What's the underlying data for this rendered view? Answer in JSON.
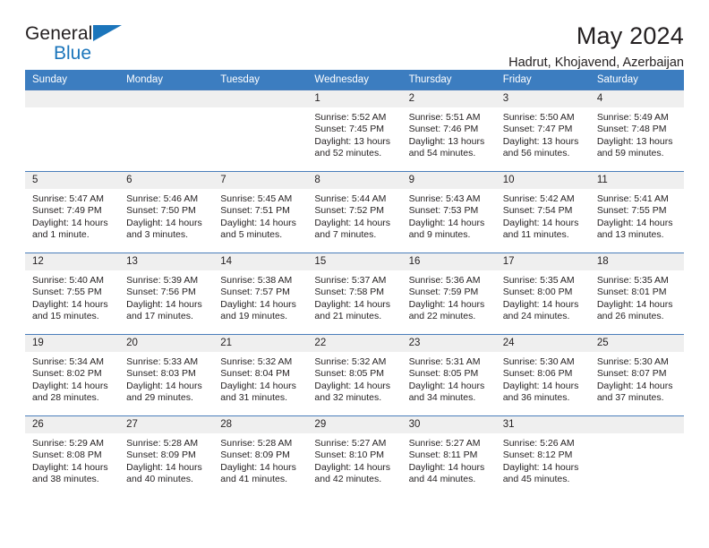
{
  "brand": {
    "name_part1": "General",
    "name_part2": "Blue",
    "accent_color": "#1b75bb"
  },
  "header": {
    "title": "May 2024",
    "subtitle": "Hadrut, Khojavend, Azerbaijan"
  },
  "calendar": {
    "header_bg": "#3c7dc0",
    "daynum_bg": "#efefef",
    "weekday_headers": [
      "Sunday",
      "Monday",
      "Tuesday",
      "Wednesday",
      "Thursday",
      "Friday",
      "Saturday"
    ],
    "weeks": [
      [
        {
          "day": "",
          "sunrise": "",
          "sunset": "",
          "daylight_line1": "",
          "daylight_line2": ""
        },
        {
          "day": "",
          "sunrise": "",
          "sunset": "",
          "daylight_line1": "",
          "daylight_line2": ""
        },
        {
          "day": "",
          "sunrise": "",
          "sunset": "",
          "daylight_line1": "",
          "daylight_line2": ""
        },
        {
          "day": "1",
          "sunrise": "Sunrise: 5:52 AM",
          "sunset": "Sunset: 7:45 PM",
          "daylight_line1": "Daylight: 13 hours",
          "daylight_line2": "and 52 minutes."
        },
        {
          "day": "2",
          "sunrise": "Sunrise: 5:51 AM",
          "sunset": "Sunset: 7:46 PM",
          "daylight_line1": "Daylight: 13 hours",
          "daylight_line2": "and 54 minutes."
        },
        {
          "day": "3",
          "sunrise": "Sunrise: 5:50 AM",
          "sunset": "Sunset: 7:47 PM",
          "daylight_line1": "Daylight: 13 hours",
          "daylight_line2": "and 56 minutes."
        },
        {
          "day": "4",
          "sunrise": "Sunrise: 5:49 AM",
          "sunset": "Sunset: 7:48 PM",
          "daylight_line1": "Daylight: 13 hours",
          "daylight_line2": "and 59 minutes."
        }
      ],
      [
        {
          "day": "5",
          "sunrise": "Sunrise: 5:47 AM",
          "sunset": "Sunset: 7:49 PM",
          "daylight_line1": "Daylight: 14 hours",
          "daylight_line2": "and 1 minute."
        },
        {
          "day": "6",
          "sunrise": "Sunrise: 5:46 AM",
          "sunset": "Sunset: 7:50 PM",
          "daylight_line1": "Daylight: 14 hours",
          "daylight_line2": "and 3 minutes."
        },
        {
          "day": "7",
          "sunrise": "Sunrise: 5:45 AM",
          "sunset": "Sunset: 7:51 PM",
          "daylight_line1": "Daylight: 14 hours",
          "daylight_line2": "and 5 minutes."
        },
        {
          "day": "8",
          "sunrise": "Sunrise: 5:44 AM",
          "sunset": "Sunset: 7:52 PM",
          "daylight_line1": "Daylight: 14 hours",
          "daylight_line2": "and 7 minutes."
        },
        {
          "day": "9",
          "sunrise": "Sunrise: 5:43 AM",
          "sunset": "Sunset: 7:53 PM",
          "daylight_line1": "Daylight: 14 hours",
          "daylight_line2": "and 9 minutes."
        },
        {
          "day": "10",
          "sunrise": "Sunrise: 5:42 AM",
          "sunset": "Sunset: 7:54 PM",
          "daylight_line1": "Daylight: 14 hours",
          "daylight_line2": "and 11 minutes."
        },
        {
          "day": "11",
          "sunrise": "Sunrise: 5:41 AM",
          "sunset": "Sunset: 7:55 PM",
          "daylight_line1": "Daylight: 14 hours",
          "daylight_line2": "and 13 minutes."
        }
      ],
      [
        {
          "day": "12",
          "sunrise": "Sunrise: 5:40 AM",
          "sunset": "Sunset: 7:55 PM",
          "daylight_line1": "Daylight: 14 hours",
          "daylight_line2": "and 15 minutes."
        },
        {
          "day": "13",
          "sunrise": "Sunrise: 5:39 AM",
          "sunset": "Sunset: 7:56 PM",
          "daylight_line1": "Daylight: 14 hours",
          "daylight_line2": "and 17 minutes."
        },
        {
          "day": "14",
          "sunrise": "Sunrise: 5:38 AM",
          "sunset": "Sunset: 7:57 PM",
          "daylight_line1": "Daylight: 14 hours",
          "daylight_line2": "and 19 minutes."
        },
        {
          "day": "15",
          "sunrise": "Sunrise: 5:37 AM",
          "sunset": "Sunset: 7:58 PM",
          "daylight_line1": "Daylight: 14 hours",
          "daylight_line2": "and 21 minutes."
        },
        {
          "day": "16",
          "sunrise": "Sunrise: 5:36 AM",
          "sunset": "Sunset: 7:59 PM",
          "daylight_line1": "Daylight: 14 hours",
          "daylight_line2": "and 22 minutes."
        },
        {
          "day": "17",
          "sunrise": "Sunrise: 5:35 AM",
          "sunset": "Sunset: 8:00 PM",
          "daylight_line1": "Daylight: 14 hours",
          "daylight_line2": "and 24 minutes."
        },
        {
          "day": "18",
          "sunrise": "Sunrise: 5:35 AM",
          "sunset": "Sunset: 8:01 PM",
          "daylight_line1": "Daylight: 14 hours",
          "daylight_line2": "and 26 minutes."
        }
      ],
      [
        {
          "day": "19",
          "sunrise": "Sunrise: 5:34 AM",
          "sunset": "Sunset: 8:02 PM",
          "daylight_line1": "Daylight: 14 hours",
          "daylight_line2": "and 28 minutes."
        },
        {
          "day": "20",
          "sunrise": "Sunrise: 5:33 AM",
          "sunset": "Sunset: 8:03 PM",
          "daylight_line1": "Daylight: 14 hours",
          "daylight_line2": "and 29 minutes."
        },
        {
          "day": "21",
          "sunrise": "Sunrise: 5:32 AM",
          "sunset": "Sunset: 8:04 PM",
          "daylight_line1": "Daylight: 14 hours",
          "daylight_line2": "and 31 minutes."
        },
        {
          "day": "22",
          "sunrise": "Sunrise: 5:32 AM",
          "sunset": "Sunset: 8:05 PM",
          "daylight_line1": "Daylight: 14 hours",
          "daylight_line2": "and 32 minutes."
        },
        {
          "day": "23",
          "sunrise": "Sunrise: 5:31 AM",
          "sunset": "Sunset: 8:05 PM",
          "daylight_line1": "Daylight: 14 hours",
          "daylight_line2": "and 34 minutes."
        },
        {
          "day": "24",
          "sunrise": "Sunrise: 5:30 AM",
          "sunset": "Sunset: 8:06 PM",
          "daylight_line1": "Daylight: 14 hours",
          "daylight_line2": "and 36 minutes."
        },
        {
          "day": "25",
          "sunrise": "Sunrise: 5:30 AM",
          "sunset": "Sunset: 8:07 PM",
          "daylight_line1": "Daylight: 14 hours",
          "daylight_line2": "and 37 minutes."
        }
      ],
      [
        {
          "day": "26",
          "sunrise": "Sunrise: 5:29 AM",
          "sunset": "Sunset: 8:08 PM",
          "daylight_line1": "Daylight: 14 hours",
          "daylight_line2": "and 38 minutes."
        },
        {
          "day": "27",
          "sunrise": "Sunrise: 5:28 AM",
          "sunset": "Sunset: 8:09 PM",
          "daylight_line1": "Daylight: 14 hours",
          "daylight_line2": "and 40 minutes."
        },
        {
          "day": "28",
          "sunrise": "Sunrise: 5:28 AM",
          "sunset": "Sunset: 8:09 PM",
          "daylight_line1": "Daylight: 14 hours",
          "daylight_line2": "and 41 minutes."
        },
        {
          "day": "29",
          "sunrise": "Sunrise: 5:27 AM",
          "sunset": "Sunset: 8:10 PM",
          "daylight_line1": "Daylight: 14 hours",
          "daylight_line2": "and 42 minutes."
        },
        {
          "day": "30",
          "sunrise": "Sunrise: 5:27 AM",
          "sunset": "Sunset: 8:11 PM",
          "daylight_line1": "Daylight: 14 hours",
          "daylight_line2": "and 44 minutes."
        },
        {
          "day": "31",
          "sunrise": "Sunrise: 5:26 AM",
          "sunset": "Sunset: 8:12 PM",
          "daylight_line1": "Daylight: 14 hours",
          "daylight_line2": "and 45 minutes."
        },
        {
          "day": "",
          "sunrise": "",
          "sunset": "",
          "daylight_line1": "",
          "daylight_line2": ""
        }
      ]
    ]
  }
}
